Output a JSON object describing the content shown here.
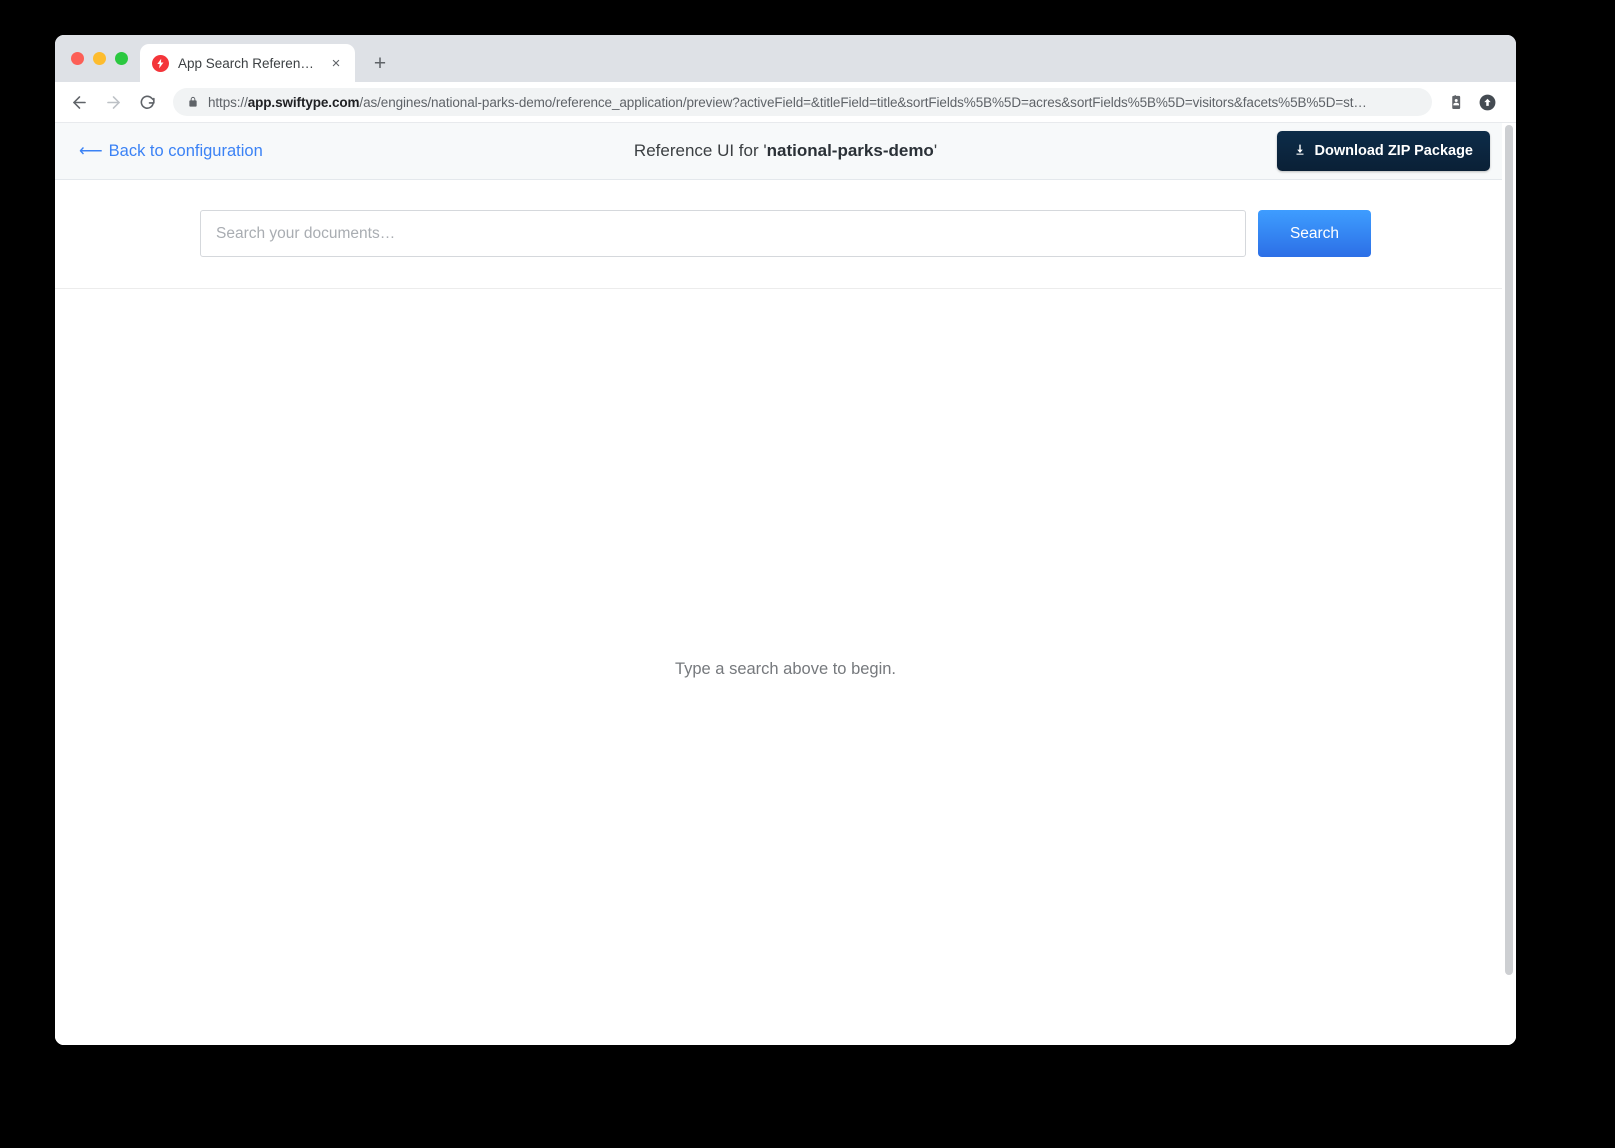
{
  "browser": {
    "tab": {
      "title": "App Search Reference UI",
      "favicon_name": "swiftype-bolt-icon",
      "favicon_color": "#f4353a",
      "close_label": "×"
    },
    "new_tab_label": "+",
    "nav": {
      "back_label": "←",
      "forward_label": "→",
      "reload_label": "⟳"
    },
    "omnibox": {
      "scheme": "https://",
      "host": "app.swiftype.com",
      "path": "/as/engines/national-parks-demo/reference_application/preview?activeField=&titleField=title&sortFields%5B%5D=acres&sortFields%5B%5D=visitors&facets%5B%5D=st…",
      "lock_icon": "lock-icon"
    },
    "toolbar_icons": [
      {
        "name": "profile-card-icon"
      },
      {
        "name": "account-upload-icon"
      }
    ]
  },
  "app": {
    "header": {
      "back_arrow": "⟵",
      "back_label": "Back to configuration",
      "title_prefix": "Reference UI for '",
      "title_engine": "national-parks-demo",
      "title_suffix": "'",
      "download_icon": "download-arrow-icon",
      "download_label": "Download ZIP Package",
      "accent_link_color": "#3b82f5",
      "download_button_color": "#0d2c49"
    },
    "search": {
      "placeholder": "Search your documents…",
      "value": "",
      "button_label": "Search",
      "button_color": "#3e9dff"
    },
    "results": {
      "empty_state": "Type a search above to begin."
    }
  }
}
